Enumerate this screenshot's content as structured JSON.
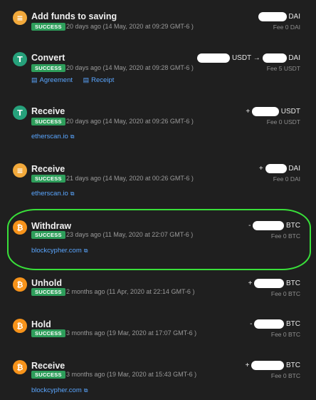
{
  "transactions": [
    {
      "type": "Add funds to saving",
      "status": "SUCCESS",
      "date": "20 days ago (14 May, 2020 at 09:29 GMT-6 )",
      "amount_prefix": "",
      "amount_currency": "DAI",
      "fee": "Fee 0 DAI",
      "icon": "dai-coin-icon",
      "icon_glyph": "≡"
    },
    {
      "type": "Convert",
      "status": "SUCCESS",
      "date": "20 days ago (14 May, 2020 at 09:28 GMT-6 )",
      "amount_from_currency": "USDT",
      "amount_arrow": "→",
      "amount_to_currency": "DAI",
      "fee": "Fee 5 USDT",
      "icon": "usdt-coin-icon",
      "icon_glyph": "T",
      "links": [
        "Agreement",
        "Receipt"
      ]
    },
    {
      "type": "Receive",
      "status": "SUCCESS",
      "date": "20 days ago (14 May, 2020 at 09:26 GMT-6 )",
      "amount_prefix": "+",
      "amount_currency": "USDT",
      "fee": "Fee 0 USDT",
      "icon": "usdt-coin-icon",
      "icon_glyph": "T",
      "link": "etherscan.io"
    },
    {
      "type": "Receive",
      "status": "SUCCESS",
      "date": "21 days ago (14 May, 2020 at 00:26 GMT-6 )",
      "amount_prefix": "+",
      "amount_currency": "DAI",
      "fee": "Fee 0 DAI",
      "icon": "dai-coin-icon",
      "icon_glyph": "≡",
      "link": "etherscan.io"
    },
    {
      "type": "Withdraw",
      "status": "SUCCESS",
      "date": "23 days ago (11 May, 2020 at 22:07 GMT-6 )",
      "amount_prefix": "-",
      "amount_currency": "BTC",
      "fee": "Fee 0 BTC",
      "icon": "btc-coin-icon",
      "icon_glyph": "₿",
      "link": "blockcypher.com"
    },
    {
      "type": "Unhold",
      "status": "SUCCESS",
      "date": "2 months ago (11 Apr, 2020 at 22:14 GMT-6 )",
      "amount_prefix": "+",
      "amount_currency": "BTC",
      "fee": "Fee 0 BTC",
      "icon": "btc-coin-icon",
      "icon_glyph": "₿"
    },
    {
      "type": "Hold",
      "status": "SUCCESS",
      "date": "3 months ago (19 Mar, 2020 at 17:07 GMT-6 )",
      "amount_prefix": "-",
      "amount_currency": "BTC",
      "fee": "Fee 0 BTC",
      "icon": "btc-coin-icon",
      "icon_glyph": "₿"
    },
    {
      "type": "Receive",
      "status": "SUCCESS",
      "date": "3 months ago (19 Mar, 2020 at 15:43 GMT-6 )",
      "amount_prefix": "+",
      "amount_currency": "BTC",
      "fee": "Fee 0 BTC",
      "icon": "btc-coin-icon",
      "icon_glyph": "₿",
      "link": "blockcypher.com"
    }
  ],
  "external_link_glyph": "⧉",
  "doc_glyph": "▤",
  "colors": {
    "background": "#1f1f1f",
    "success": "#2e9e5b",
    "link": "#5aa6ff",
    "highlight": "#39e03a"
  }
}
